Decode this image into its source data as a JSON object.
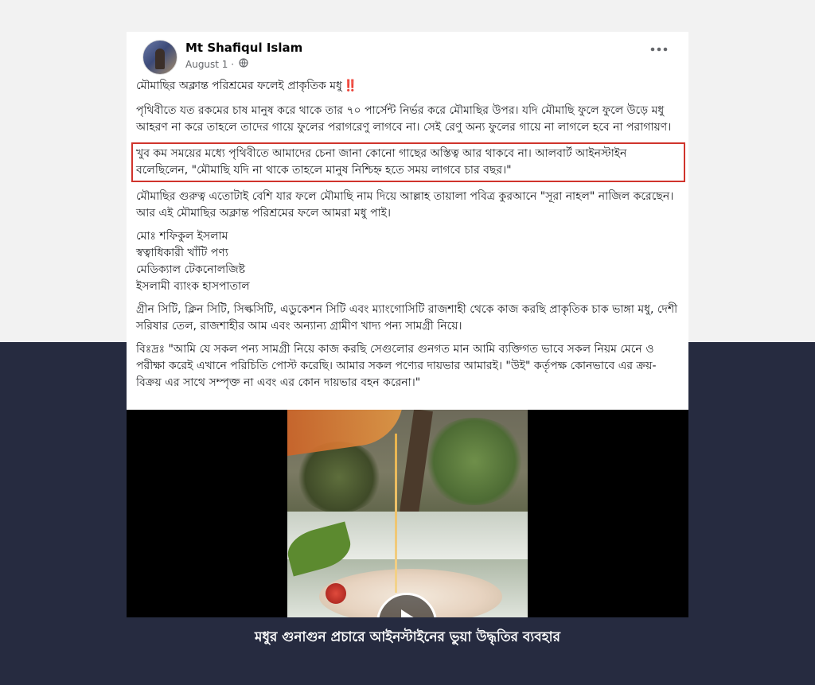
{
  "post": {
    "author": "Mt Shafiqul Islam",
    "date": "August 1 ·",
    "privacy_icon": "globe-icon",
    "more_icon": "more-options-icon",
    "title": "মৌমাছির অক্লান্ত পরিশ্রমের ফলেই প্রাকৃতিক মধু",
    "title_emoji": "‼️",
    "paragraph1": "পৃথিবীতে যত রকমের চাষ মানুষ করে থাকে তার ৭০ পার্সেন্ট নির্ভর করে মৌমাছির উপর। যদি মৌমাছি ফুলে ফুলে উড়ে মধু আহরণ না করে তাহলে তাদের গায়ে ফুলের পরাগরেণু লাগবে না। সেই রেণু অন্য ফুলের গায়ে না লাগলে হবে না পরাগায়ণ।",
    "paragraph2_highlighted": "খুব কম সময়ের মধ্যে পৃথিবীতে আমাদের চেনা জানা কোনো গাছের অস্তিত্ব আর থাকবে না। আলবার্ট আইনস্টাইন বলেছিলেন, \"মৌমাছি যদি না থাকে তাহলে মানুষ নিশ্চিহ্ন হতে সময় লাগবে চার বছর।\"",
    "paragraph3": "মৌমাছির গুরুত্ব এতোটাই বেশি যার ফলে মৌমাছি নাম দিয়ে আল্লাহ তায়ালা পবিত্র কুরআনে \"সূরা নাহল\" নাজিল করেছেন। আর এই মৌমাছির অক্লান্ত পরিশ্রমের ফলে আমরা মধু পাই।",
    "signature": [
      "মোঃ শফিকুল ইসলাম",
      "স্বত্বাধিকারী খাঁটি পণ্য",
      "মেডিক্যাল টেকনোলজিষ্ট",
      "ইসলামী ব্যাংক হাসপাতাল"
    ],
    "paragraph4": "গ্রীন সিটি, ক্লিন সিটি, সিল্কসিটি, এডুকেশন সিটি এবং ম্যাংগোসিটি রাজশাহী থেকে কাজ করছি প্রাকৃতিক চাক ভাঙ্গা মধু, দেশী সরিষার তেল, রাজশাহীর আম এবং অন্যান্য গ্রামীণ খাদ্য পন্য সামগ্রী নিয়ে।",
    "paragraph5": "বিঃদ্রঃ \"আমি যে সকল পন্য সামগ্রী নিয়ে কাজ করছি সেগুলোর গুনগত মান আমি ব্যক্তিগত ভাবে সকল নিয়ম মেনে ও পরীক্ষা করেই এখানে পরিচিতি  পোস্ট করেছি। আমার সকল পণ্যের দায়ভার আমারই। \"উই\"  কর্তৃপক্ষ কোনভাবে এর ক্রয়-বিক্রয় এর সাথে সম্পৃক্ত না এবং এর কোন দায়ভার বহন করেনা।\""
  },
  "video": {
    "play_icon": "play-icon"
  },
  "caption": "মধুর গুনাগুন প্রচারে আইনস্টাইনের ভুয়া উদ্ধৃতির ব্যবহার",
  "colors": {
    "highlight_border": "#d0342c",
    "bottom_background": "#262b40",
    "top_background": "#f2f2f2"
  }
}
